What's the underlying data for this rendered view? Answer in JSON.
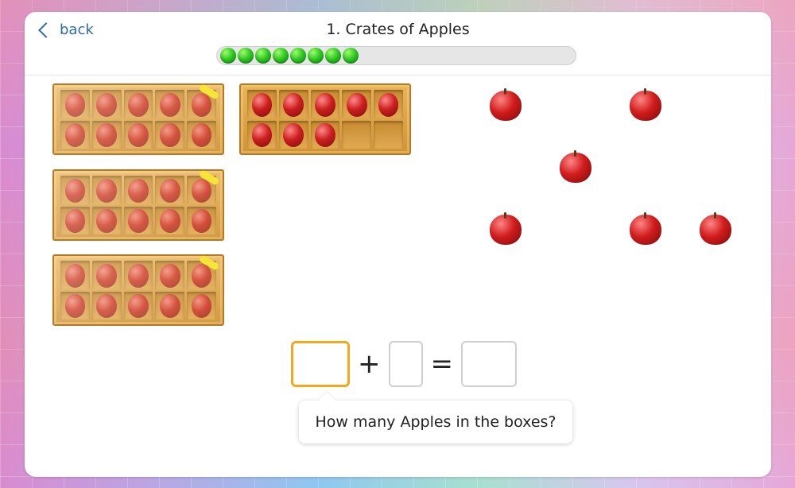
{
  "header": {
    "back_label": "back",
    "title": "1. Crates of Apples",
    "progress_completed": 8,
    "progress_total": 20
  },
  "crates": [
    {
      "filled": 10,
      "wrapped": true
    },
    {
      "filled": 8,
      "wrapped": false
    },
    {
      "filled": 10,
      "wrapped": true
    },
    {
      "filled": 10,
      "wrapped": true
    }
  ],
  "loose_apples_count": 6,
  "equation": {
    "operator_plus": "+",
    "operator_equals": "="
  },
  "tooltip": {
    "text": "How many Apples in the boxes?"
  },
  "colors": {
    "accent": "#f2a81d",
    "link": "#2d6aa8",
    "progress_fill": "#2bc21f"
  }
}
